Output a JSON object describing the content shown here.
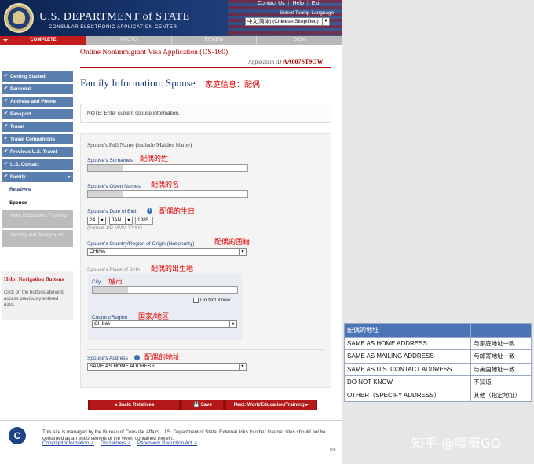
{
  "header": {
    "dept_title": "U.S. DEPARTMENT of STATE",
    "dept_subtitle": "CONSULAR ELECTRONIC APPLICATION CENTER",
    "links": [
      "Contact Us",
      "Help",
      "Exit"
    ],
    "tooltip_language_label": "Select Tooltip Language",
    "tooltip_language_value": "中文(简体) (Chinese-Simplified)"
  },
  "steps": {
    "complete": "COMPLETE",
    "photo": "PHOTO",
    "review": "REVIEW",
    "sign": "SIGN"
  },
  "sidebar": {
    "items": [
      "Getting Started",
      "Personal",
      "Address and Phone",
      "Passport",
      "Travel",
      "Travel Companions",
      "Previous U.S. Travel",
      "U.S. Contact",
      "Family"
    ],
    "sub_items": [
      "Relatives",
      "Spouse"
    ],
    "sub_disabled": [
      "Work / Education / Training",
      "Security and Background"
    ],
    "help_title": "Help: Navigation Buttons",
    "help_text": "Click on the buttons above to access previously entered data."
  },
  "form": {
    "app_title": "Online Nonimmigrant Visa Application (DS-160)",
    "app_id_label": "Application ID",
    "app_id": "AA007ST9OW",
    "page_title": "Family Information: Spouse",
    "page_title_cn": "家庭信息：配偶",
    "note": "NOTE: Enter current spouse information.",
    "full_name_heading": "Spouse's Full Name (include Maiden Name)",
    "surnames_label": "Spouse's Surnames",
    "surnames_cn": "配偶的姓",
    "given_names_label": "Spouse's Given Names",
    "given_names_cn": "配偶的名",
    "dob_label": "Spouse's Date of Birth",
    "dob_cn": "配偶的生日",
    "dob_day": "24",
    "dob_month": "JAN",
    "dob_year": "1985",
    "dob_format": "(Format: DD-MMM-YYYY)",
    "nationality_label": "Spouse's Country/Region of Origin (Nationality)",
    "nationality_cn": "配偶的国籍",
    "nationality_value": "CHINA",
    "pob_label": "Spouse's Place of Birth",
    "pob_cn": "配偶的出生地",
    "city_label": "City",
    "city_cn": "城市",
    "do_not_know": "Do Not Know",
    "country_label": "Country/Region",
    "country_cn": "国家/地区",
    "country_value": "CHINA",
    "address_label": "Spouse's Address",
    "address_cn": "配偶的地址",
    "address_value": "SAME AS HOME ADDRESS"
  },
  "buttons": {
    "back": "◂ Back: Relatives",
    "save": "💾 Save",
    "next": "Next: Work/Education/Training ▸"
  },
  "footer": {
    "logo": "C",
    "text": "This site is managed by the Bureau of Consular Affairs, U.S. Department of State. External links to other Internet sites should not be construed as an endorsement of the views contained therein.",
    "links": [
      "Copyright Information ↗",
      "Disclaimers ↗",
      "Paperwork Reduction Act ↗"
    ],
    "small": "[84]"
  },
  "address_table": {
    "header": "配偶的地址",
    "rows": [
      [
        "SAME AS HOME ADDRESS",
        "与家庭地址一致"
      ],
      [
        "SAME AS MAILING ADDRESS",
        "与邮寄地址一致"
      ],
      [
        "SAME AS U.S. CONTACT ADDRESS",
        "与美国地址一致"
      ],
      [
        "DO NOT KNOW",
        "不知道"
      ],
      [
        "OTHER（SPECIFY ADDRESS）",
        "其他（指定地址）"
      ]
    ]
  },
  "watermark": "知乎 @嘿薇GO",
  "colors": {
    "header_navy": "#0c2350",
    "step_active": "#c41c1c",
    "nav_blue": "#5a7fae",
    "annotation_red": "#e00000",
    "table_header_blue": "#4a74b6"
  }
}
